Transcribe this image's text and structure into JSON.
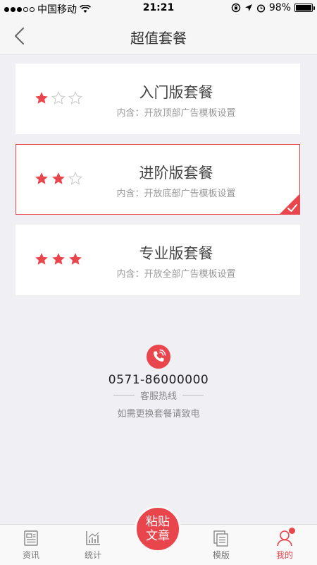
{
  "status_bar": {
    "carrier": "中国移动",
    "time": "21:21",
    "battery": "98%",
    "battery_level": 0.98
  },
  "nav": {
    "title": "超值套餐",
    "back_icon": "chevron-left-icon"
  },
  "packages": [
    {
      "title": "入门版套餐",
      "desc": "内含：开放顶部广告模板设置",
      "stars": 1,
      "max_stars": 3,
      "selected": false
    },
    {
      "title": "进阶版套餐",
      "desc": "内含：开放底部广告模板设置",
      "stars": 2,
      "max_stars": 3,
      "selected": true
    },
    {
      "title": "专业版套餐",
      "desc": "内含：开放全部广告模板设置",
      "stars": 3,
      "max_stars": 3,
      "selected": false
    }
  ],
  "hotline": {
    "number": "0571-86000000",
    "label": "客服热线",
    "note": "如需更换套餐请致电"
  },
  "tab_bar": {
    "tabs": [
      {
        "label": "资讯",
        "icon": "news-icon"
      },
      {
        "label": "统计",
        "icon": "chart-icon"
      },
      {
        "label": "模版",
        "icon": "template-icon"
      },
      {
        "label": "我的",
        "icon": "profile-icon",
        "active": true,
        "badge": true
      }
    ],
    "paste_button": {
      "line1": "粘贴",
      "line2": "文章"
    }
  },
  "colors": {
    "accent": "#e8464c",
    "background": "#efeff4"
  }
}
